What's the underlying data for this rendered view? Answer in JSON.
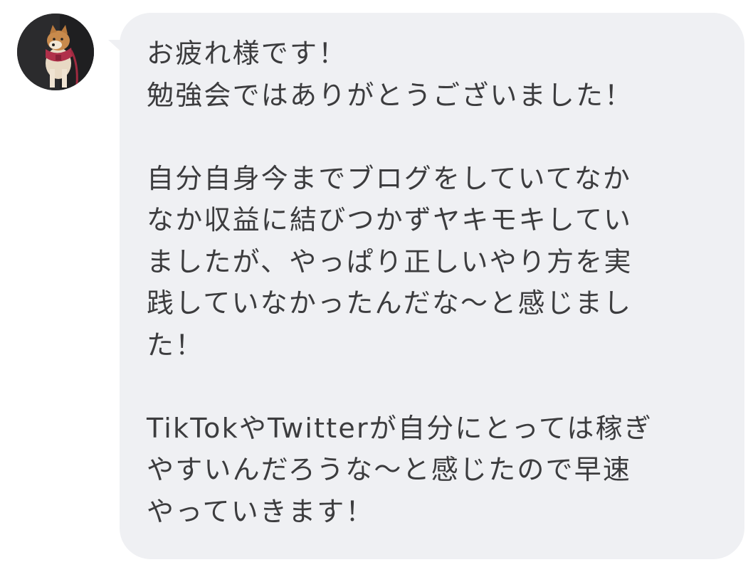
{
  "message": {
    "lines": [
      "お疲れ様です！",
      "勉強会ではありがとうございました！",
      "",
      "自分自身今までブログをしていてなか",
      "なか収益に結びつかずヤキモキしてい",
      "ましたが、やっぱり正しいやり方を実",
      "践していなかったんだな〜と感じまし",
      "た！",
      "",
      "TikTokやTwitterが自分にとっては稼ぎ",
      "やすいんだろうな〜と感じたので早速",
      "やっていきます！"
    ]
  },
  "avatar": {
    "icon": "shiba-dog-photo"
  },
  "colors": {
    "bubble": "#eff0f3",
    "text": "#3c3c3e"
  }
}
